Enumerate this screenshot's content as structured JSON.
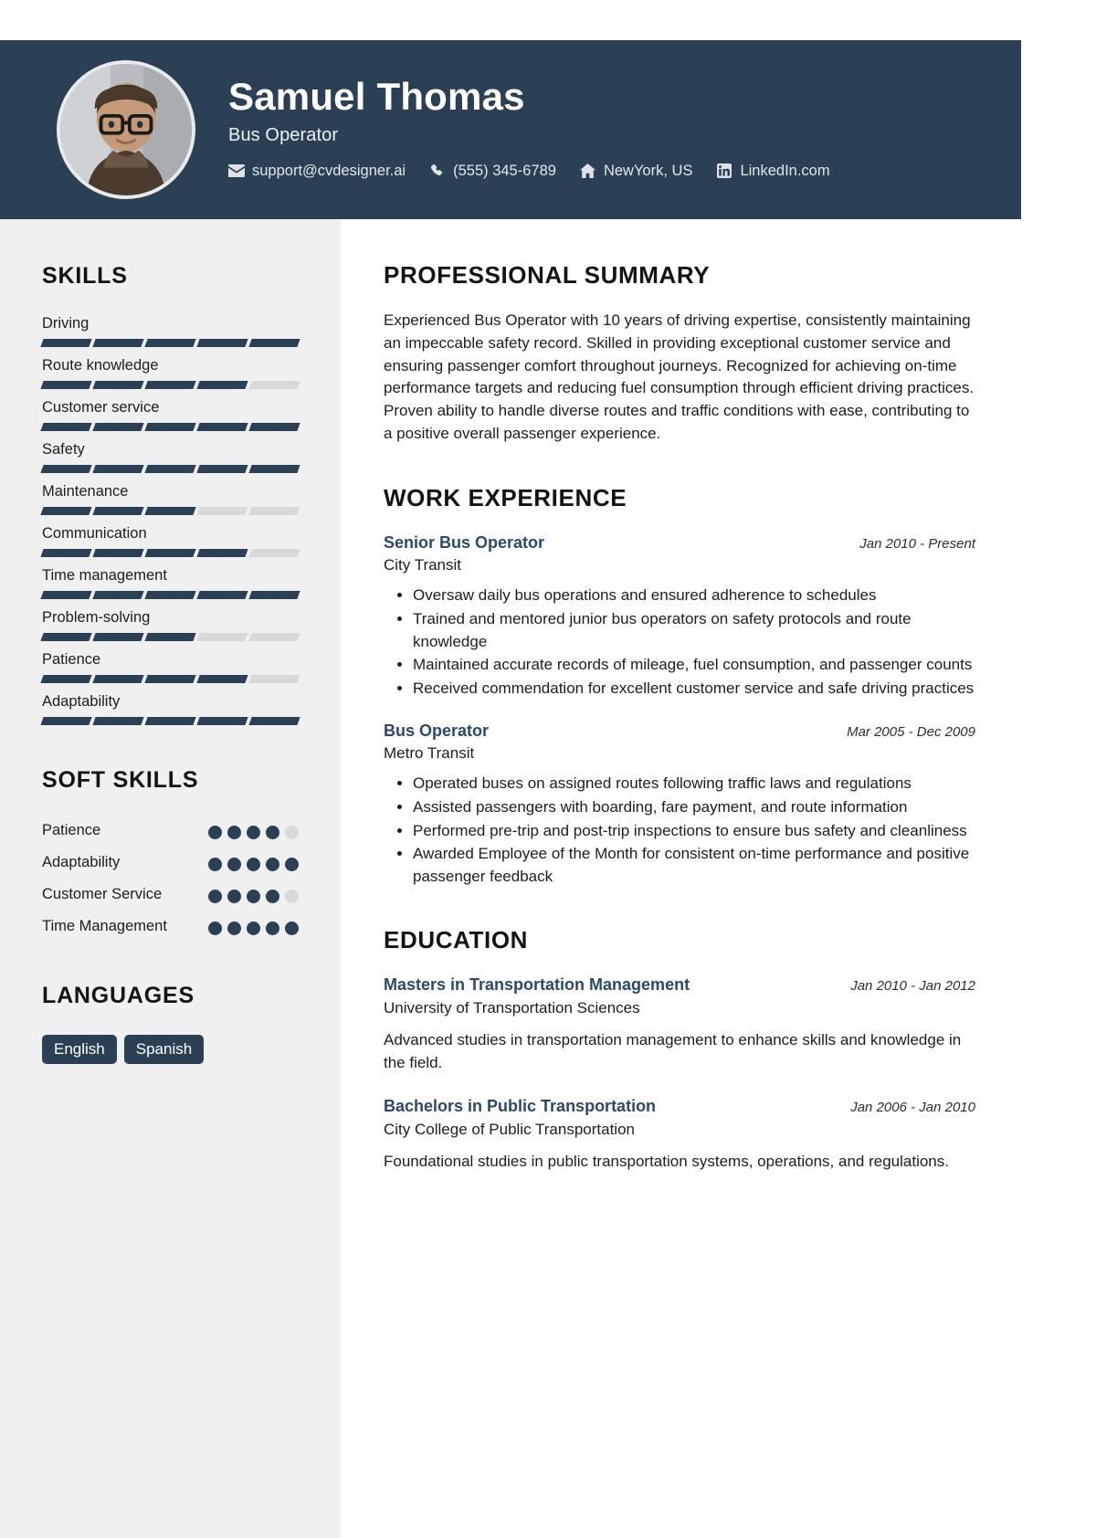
{
  "header": {
    "name": "Samuel Thomas",
    "job_title": "Bus Operator",
    "avatar_alt": "profile-photo",
    "contacts": [
      {
        "icon": "envelope-icon",
        "text": "support@cvdesigner.ai"
      },
      {
        "icon": "phone-icon",
        "text": "(555) 345-6789"
      },
      {
        "icon": "home-icon",
        "text": "NewYork, US"
      },
      {
        "icon": "linkedin-icon",
        "text": "LinkedIn.com"
      }
    ],
    "bg_color": "#2b4055"
  },
  "sidebar": {
    "skills_heading": "SKILLS",
    "skills": [
      {
        "label": "Driving",
        "level": 5,
        "max": 5
      },
      {
        "label": "Route knowledge",
        "level": 4,
        "max": 5
      },
      {
        "label": "Customer service",
        "level": 5,
        "max": 5
      },
      {
        "label": "Safety",
        "level": 5,
        "max": 5
      },
      {
        "label": "Maintenance",
        "level": 3,
        "max": 5
      },
      {
        "label": "Communication",
        "level": 4,
        "max": 5
      },
      {
        "label": "Time management",
        "level": 5,
        "max": 5
      },
      {
        "label": "Problem-solving",
        "level": 3,
        "max": 5
      },
      {
        "label": "Patience",
        "level": 4,
        "max": 5
      },
      {
        "label": "Adaptability",
        "level": 5,
        "max": 5
      }
    ],
    "soft_skills_heading": "SOFT SKILLS",
    "soft_skills": [
      {
        "label": "Patience",
        "level": 4,
        "max": 5
      },
      {
        "label": "Adaptability",
        "level": 5,
        "max": 5
      },
      {
        "label": "Customer Service",
        "level": 4,
        "max": 5
      },
      {
        "label": "Time Management",
        "level": 5,
        "max": 5
      }
    ],
    "languages_heading": "LANGUAGES",
    "languages": [
      "English",
      "Spanish"
    ],
    "accent_color": "#2b4055",
    "track_color": "#d9d9d9",
    "bg_color": "#f0f0f0"
  },
  "main": {
    "summary_heading": "PROFESSIONAL SUMMARY",
    "summary_text": "Experienced Bus Operator with 10 years of driving expertise, consistently maintaining an impeccable safety record. Skilled in providing exceptional customer service and ensuring passenger comfort throughout journeys. Recognized for achieving on-time performance targets and reducing fuel consumption through efficient driving practices. Proven ability to handle diverse routes and traffic conditions with ease, contributing to a positive overall passenger experience.",
    "experience_heading": "WORK EXPERIENCE",
    "experience": [
      {
        "title": "Senior Bus Operator",
        "date": "Jan 2010 - Present",
        "organization": "City Transit",
        "bullets": [
          "Oversaw daily bus operations and ensured adherence to schedules",
          "Trained and mentored junior bus operators on safety protocols and route knowledge",
          "Maintained accurate records of mileage, fuel consumption, and passenger counts",
          "Received commendation for excellent customer service and safe driving practices"
        ]
      },
      {
        "title": "Bus Operator",
        "date": "Mar 2005 - Dec 2009",
        "organization": "Metro Transit",
        "bullets": [
          "Operated buses on assigned routes following traffic laws and regulations",
          "Assisted passengers with boarding, fare payment, and route information",
          "Performed pre-trip and post-trip inspections to ensure bus safety and cleanliness",
          "Awarded Employee of the Month for consistent on-time performance and positive passenger feedback"
        ]
      }
    ],
    "education_heading": "EDUCATION",
    "education": [
      {
        "title": "Masters in Transportation Management",
        "date": "Jan 2010 - Jan 2012",
        "organization": "University of Transportation Sciences",
        "description": "Advanced studies in transportation management to enhance skills and knowledge in the field."
      },
      {
        "title": "Bachelors in Public Transportation",
        "date": "Jan 2006 - Jan 2010",
        "organization": "City College of Public Transportation",
        "description": "Foundational studies in public transportation systems, operations, and regulations."
      }
    ],
    "heading_color": "#141414",
    "entry_title_color": "#2b4a68"
  }
}
